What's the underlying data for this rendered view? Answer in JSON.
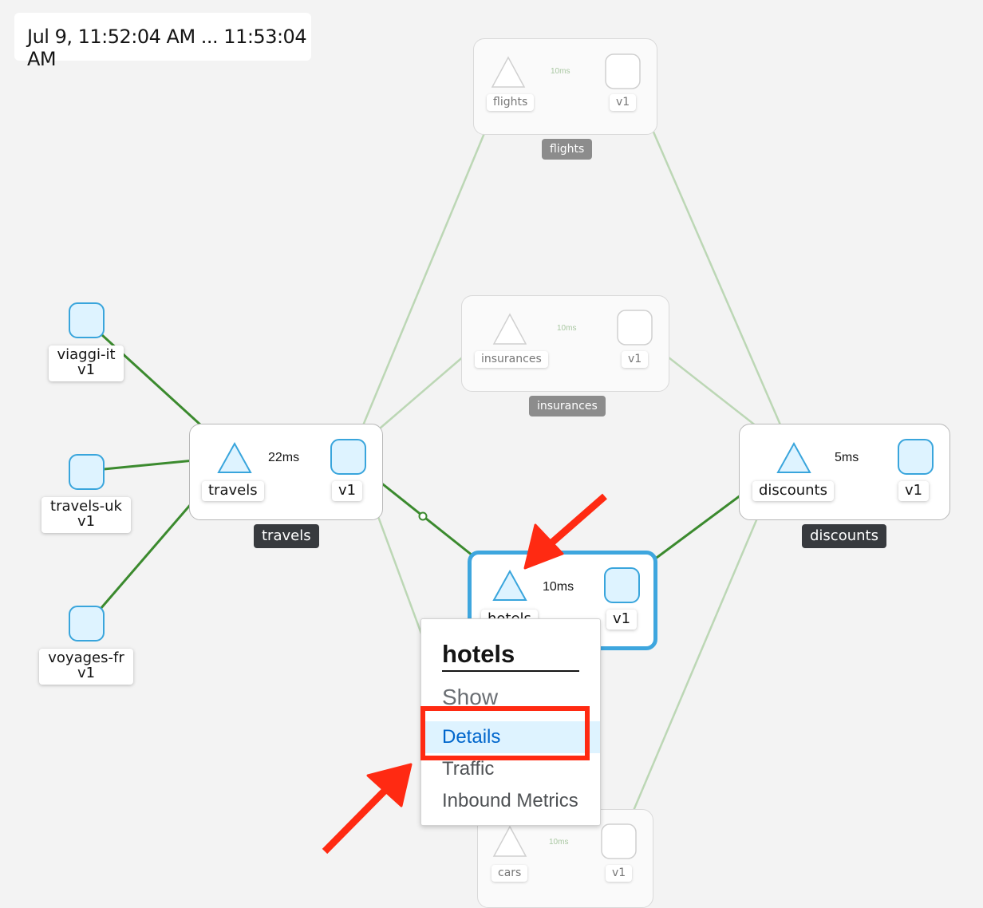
{
  "time_range": "Jul 9, 11:52:04 AM ... 11:53:04 AM",
  "boxes": {
    "flights": "flights",
    "insurances": "insurances",
    "travels": "travels",
    "discounts": "discounts"
  },
  "nodes": {
    "viaggi_it": {
      "name": "viaggi-it",
      "version": "v1"
    },
    "travels_uk": {
      "name": "travels-uk",
      "version": "v1"
    },
    "voyages_fr": {
      "name": "voyages-fr",
      "version": "v1"
    },
    "travels_svc": "travels",
    "travels_v1": "v1",
    "flights_svc": "flights",
    "flights_v1": "v1",
    "insurances_svc": "insurances",
    "insurances_v1": "v1",
    "hotels_svc": "hotels",
    "hotels_v1": "v1",
    "discounts_svc": "discounts",
    "discounts_v1": "v1",
    "cars_svc": "cars",
    "cars_v1": "v1"
  },
  "edges": {
    "travels_latency": "22ms",
    "flights_latency": "10ms",
    "insurances_latency": "10ms",
    "hotels_latency": "10ms",
    "discounts_latency": "5ms",
    "cars_latency": "10ms"
  },
  "context_menu": {
    "title": "hotels",
    "section": "Show",
    "items": [
      "Details",
      "Traffic",
      "Inbound Metrics"
    ],
    "active_item": "Details"
  },
  "colors": {
    "active_edge": "#3b8a2e",
    "inactive_edge": "#bcd7b5",
    "node_fill": "#def3ff",
    "node_stroke": "#39a5dc",
    "selection": "#3ea6de",
    "annotation": "#ff2a12"
  }
}
